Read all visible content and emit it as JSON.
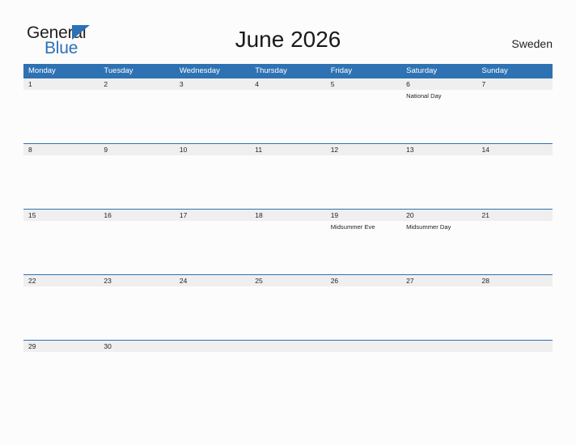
{
  "brand": {
    "name_part1": "General",
    "name_part2": "Blue",
    "flag_icon": "blue-triangle-flag",
    "color_dark": "#231f20",
    "color_blue": "#2b71b8"
  },
  "header": {
    "title": "June 2026",
    "country": "Sweden"
  },
  "calendar": {
    "month": "June",
    "year": "2026",
    "week_start": "Monday",
    "header_color": "#2e72b3",
    "date_band_color": "#efefef",
    "weekdays": [
      "Monday",
      "Tuesday",
      "Wednesday",
      "Thursday",
      "Friday",
      "Saturday",
      "Sunday"
    ],
    "weeks": [
      {
        "days": [
          {
            "date": "1",
            "event": ""
          },
          {
            "date": "2",
            "event": ""
          },
          {
            "date": "3",
            "event": ""
          },
          {
            "date": "4",
            "event": ""
          },
          {
            "date": "5",
            "event": ""
          },
          {
            "date": "6",
            "event": "National Day"
          },
          {
            "date": "7",
            "event": ""
          }
        ]
      },
      {
        "days": [
          {
            "date": "8",
            "event": ""
          },
          {
            "date": "9",
            "event": ""
          },
          {
            "date": "10",
            "event": ""
          },
          {
            "date": "11",
            "event": ""
          },
          {
            "date": "12",
            "event": ""
          },
          {
            "date": "13",
            "event": ""
          },
          {
            "date": "14",
            "event": ""
          }
        ]
      },
      {
        "days": [
          {
            "date": "15",
            "event": ""
          },
          {
            "date": "16",
            "event": ""
          },
          {
            "date": "17",
            "event": ""
          },
          {
            "date": "18",
            "event": ""
          },
          {
            "date": "19",
            "event": "Midsummer Eve"
          },
          {
            "date": "20",
            "event": "Midsummer Day"
          },
          {
            "date": "21",
            "event": ""
          }
        ]
      },
      {
        "days": [
          {
            "date": "22",
            "event": ""
          },
          {
            "date": "23",
            "event": ""
          },
          {
            "date": "24",
            "event": ""
          },
          {
            "date": "25",
            "event": ""
          },
          {
            "date": "26",
            "event": ""
          },
          {
            "date": "27",
            "event": ""
          },
          {
            "date": "28",
            "event": ""
          }
        ]
      },
      {
        "days": [
          {
            "date": "29",
            "event": ""
          },
          {
            "date": "30",
            "event": ""
          },
          {
            "date": "",
            "event": ""
          },
          {
            "date": "",
            "event": ""
          },
          {
            "date": "",
            "event": ""
          },
          {
            "date": "",
            "event": ""
          },
          {
            "date": "",
            "event": ""
          }
        ]
      }
    ]
  }
}
